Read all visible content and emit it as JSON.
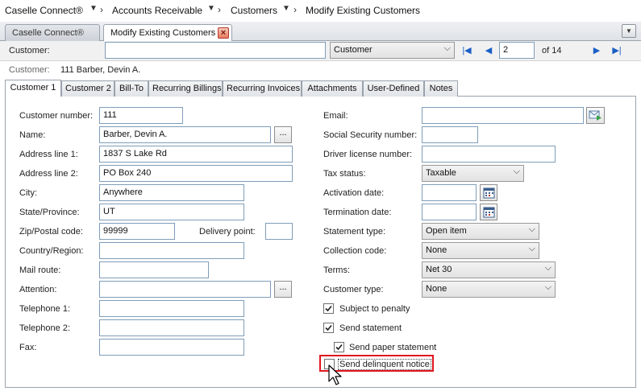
{
  "breadcrumb": {
    "items": [
      "Caselle Connect®",
      "Accounts Receivable",
      "Customers",
      "Modify Existing Customers"
    ]
  },
  "doc_tabs": {
    "caselle": "Caselle Connect®",
    "modify": "Modify Existing Customers"
  },
  "toolbar": {
    "customer_label": "Customer:",
    "customer_value": "",
    "search_type": "Customer",
    "record": "2",
    "of_total": "of 14"
  },
  "summary": {
    "label": "Customer:",
    "value": "111  Barber, Devin A."
  },
  "tabs": [
    "Customer 1",
    "Customer 2",
    "Bill-To",
    "Recurring Billings",
    "Recurring Invoices",
    "Attachments",
    "User-Defined",
    "Notes"
  ],
  "left": {
    "customer_number": {
      "label": "Customer number:",
      "value": "111"
    },
    "name": {
      "label": "Name:",
      "value": "Barber, Devin A."
    },
    "address1": {
      "label": "Address line 1:",
      "value": "1837 S Lake Rd"
    },
    "address2": {
      "label": "Address line 2:",
      "value": "PO Box 240"
    },
    "city": {
      "label": "City:",
      "value": "Anywhere"
    },
    "state": {
      "label": "State/Province:",
      "value": "UT"
    },
    "zip": {
      "label": "Zip/Postal code:",
      "value": "99999"
    },
    "delivery_point": {
      "label": "Delivery point:",
      "value": ""
    },
    "country": {
      "label": "Country/Region:",
      "value": ""
    },
    "mail_route": {
      "label": "Mail route:",
      "value": ""
    },
    "attention": {
      "label": "Attention:",
      "value": ""
    },
    "telephone1": {
      "label": "Telephone 1:",
      "value": ""
    },
    "telephone2": {
      "label": "Telephone 2:",
      "value": ""
    },
    "fax": {
      "label": "Fax:",
      "value": ""
    }
  },
  "right": {
    "email": {
      "label": "Email:",
      "value": ""
    },
    "ssn": {
      "label": "Social Security number:",
      "value": ""
    },
    "driver_license": {
      "label": "Driver license number:",
      "value": ""
    },
    "tax_status": {
      "label": "Tax status:",
      "value": "Taxable"
    },
    "activation_date": {
      "label": "Activation date:",
      "value": ""
    },
    "termination_date": {
      "label": "Termination date:",
      "value": ""
    },
    "statement_type": {
      "label": "Statement type:",
      "value": "Open item"
    },
    "collection_code": {
      "label": "Collection code:",
      "value": "None"
    },
    "terms": {
      "label": "Terms:",
      "value": "Net 30"
    },
    "customer_type": {
      "label": "Customer type:",
      "value": "None"
    }
  },
  "checkboxes": {
    "subject_to_penalty": {
      "label": "Subject to penalty",
      "checked": true
    },
    "send_statement": {
      "label": "Send statement",
      "checked": true
    },
    "send_paper_statement": {
      "label": "Send paper statement",
      "checked": true
    },
    "send_delinquent_notice": {
      "label": "Send delinquent notice",
      "checked": false
    }
  },
  "ellipsis": "...",
  "colors": {
    "highlight": "#e0161e",
    "nav_blue": "#1a5fc4"
  }
}
